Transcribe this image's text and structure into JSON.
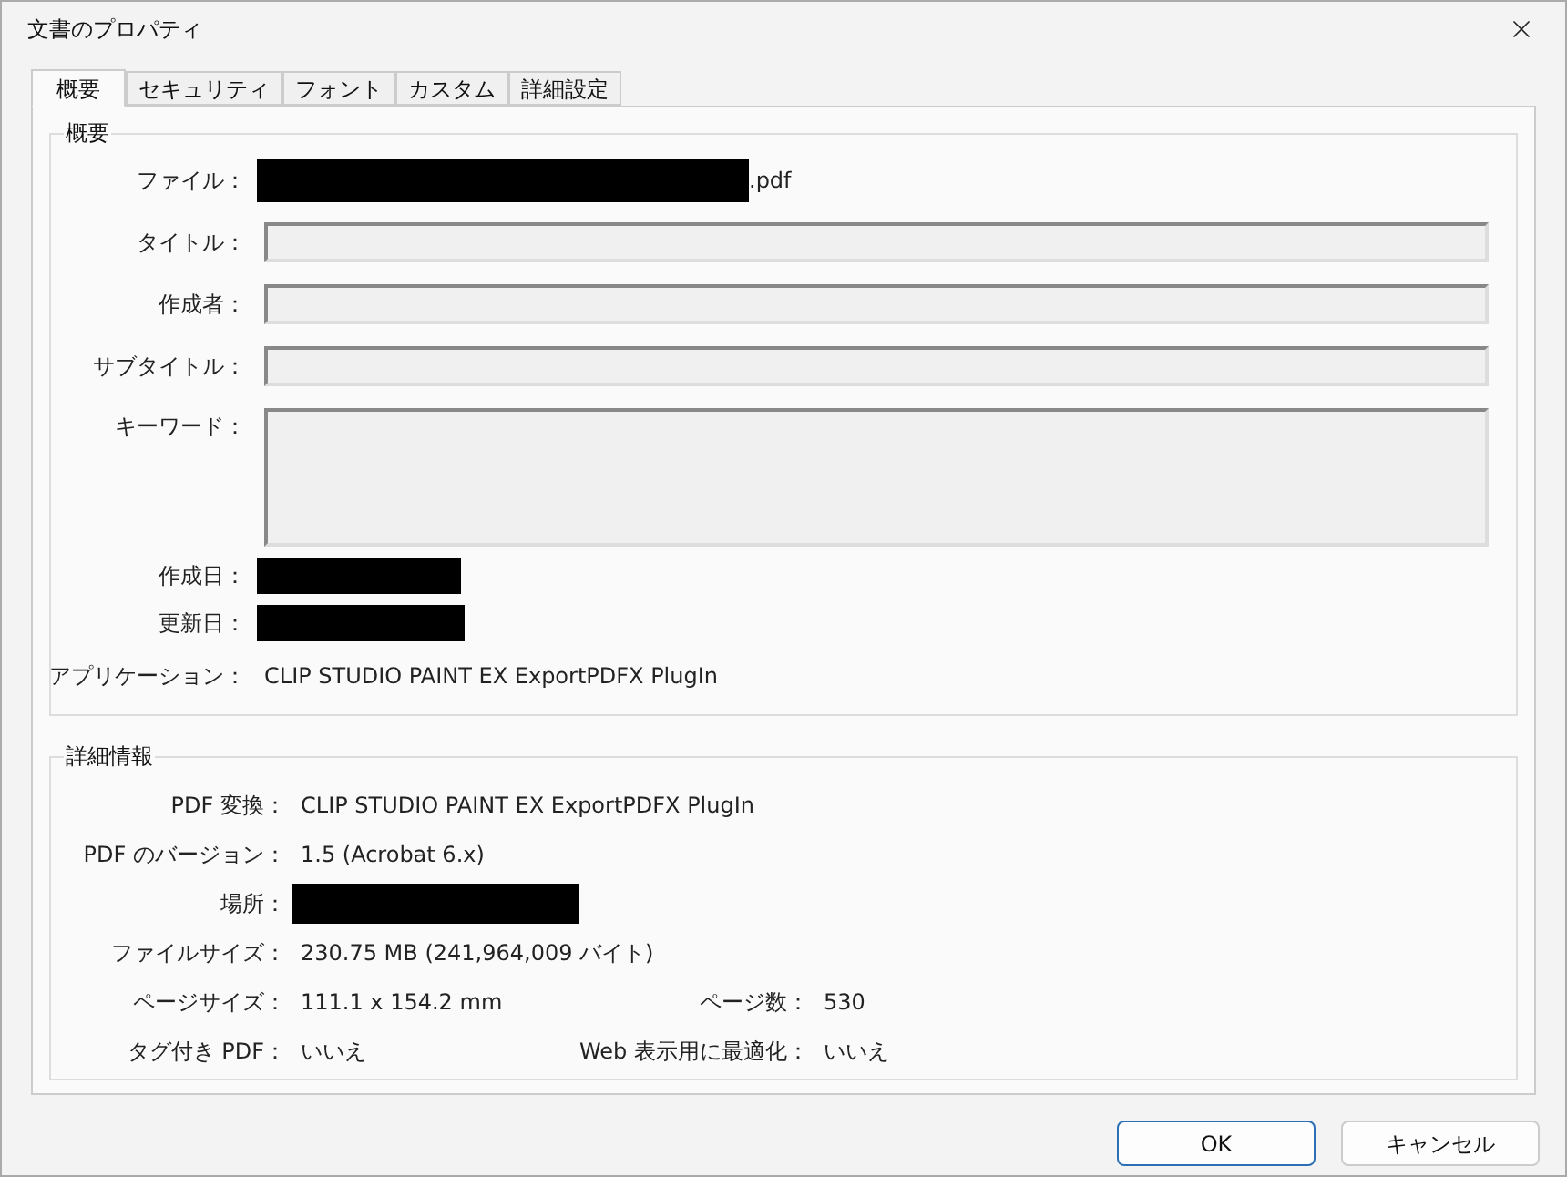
{
  "window": {
    "title": "文書のプロパティ"
  },
  "tabs": [
    {
      "label": "概要",
      "selected": true
    },
    {
      "label": "セキュリティ",
      "selected": false
    },
    {
      "label": "フォント",
      "selected": false
    },
    {
      "label": "カスタム",
      "selected": false
    },
    {
      "label": "詳細設定",
      "selected": false
    }
  ],
  "summary": {
    "title": "概要",
    "rows": [
      {
        "kind": "file",
        "label": "ファイル：",
        "suffix": ".pdf"
      },
      {
        "kind": "field",
        "label": "タイトル："
      },
      {
        "kind": "field",
        "label": "作成者："
      },
      {
        "kind": "field",
        "label": "サブタイトル："
      },
      {
        "kind": "area",
        "label": "キーワード："
      },
      {
        "kind": "redacted",
        "label": "作成日："
      },
      {
        "kind": "redacted",
        "label": "更新日："
      },
      {
        "kind": "text",
        "label": "アプリケーション：",
        "value": "CLIP STUDIO PAINT EX ExportPDFX PlugIn"
      }
    ]
  },
  "details": {
    "title": "詳細情報",
    "rows": [
      {
        "cells": [
          {
            "label": "PDF 変換：",
            "value": "CLIP STUDIO PAINT EX ExportPDFX PlugIn"
          }
        ]
      },
      {
        "cells": [
          {
            "label": "PDF のバージョン：",
            "value": "1.5 (Acrobat 6.x)"
          }
        ]
      },
      {
        "cells": [
          {
            "label": "場所：",
            "redacted": true
          }
        ]
      },
      {
        "cells": [
          {
            "label": "ファイルサイズ：",
            "value": "230.75 MB (241,964,009 バイト)"
          }
        ]
      },
      {
        "cells": [
          {
            "label": "ページサイズ：",
            "value": "111.1 x 154.2 mm"
          },
          {
            "label": "ページ数：",
            "value": "530"
          }
        ]
      },
      {
        "cells": [
          {
            "label": "タグ付き PDF：",
            "value": "いいえ"
          },
          {
            "label": "Web 表示用に最適化：",
            "value": "いいえ"
          }
        ]
      }
    ]
  },
  "buttons": [
    {
      "label": "OK",
      "default": true
    },
    {
      "label": "キャンセル",
      "default": false
    }
  ]
}
